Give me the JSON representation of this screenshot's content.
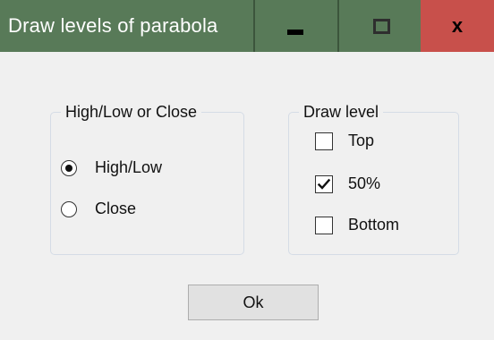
{
  "window": {
    "title": "Draw levels of parabola",
    "controls": {
      "minimize_icon": "minimize-icon",
      "maximize_icon": "maximize-icon",
      "close_label": "x"
    },
    "colors": {
      "titlebar": "#587a58",
      "close": "#c8504b"
    }
  },
  "mode_group": {
    "title": "High/Low or Close",
    "options": [
      {
        "label": "High/Low",
        "selected": true
      },
      {
        "label": "Close",
        "selected": false
      }
    ]
  },
  "levels_group": {
    "title": "Draw level",
    "options": [
      {
        "label": "Top",
        "checked": false
      },
      {
        "label": "50%",
        "checked": true
      },
      {
        "label": "Bottom",
        "checked": false
      }
    ]
  },
  "ok_button": {
    "label": "Ok"
  }
}
